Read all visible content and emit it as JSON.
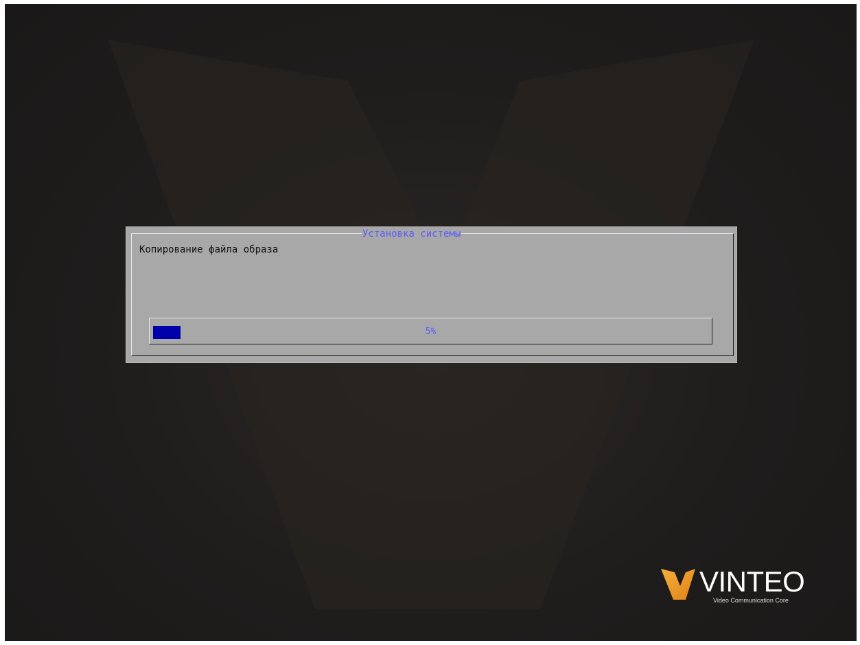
{
  "dialog": {
    "title": "Установка системы",
    "message": "Копирование файла образа",
    "progress": {
      "percent": 5,
      "label": "5%"
    }
  },
  "brand": {
    "name": "VINTEO",
    "tagline": "Video Communication Core",
    "accent_color": "#f29a1e",
    "logo_icon": "v-logo-icon"
  },
  "colors": {
    "background": "#1f1d1c",
    "dialog_bg": "#a8a8a8",
    "title_text": "#5b5bff",
    "progress_fill": "#0000aa"
  }
}
